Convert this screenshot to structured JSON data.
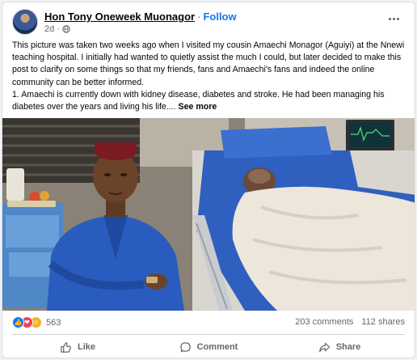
{
  "post": {
    "author": "Hon Tony Oneweek Muonagor",
    "separator": "·",
    "follow": "Follow",
    "time": "2d",
    "time_separator": "·",
    "more_icon": "more-horizontal-icon",
    "privacy_icon": "globe-icon"
  },
  "text": {
    "paragraph1": "This picture was taken two weeks ago when I visited my cousin Amaechi Monagor (Aguiyi) at the Nnewi teaching hospital. I initially had wanted to quietly assist the much I could, but later decided to make this post to clarify on some things so that my friends, fans and Amaechi's fans and indeed the online community can be better informed.",
    "paragraph2": "1. Amaechi is currently down with kidney disease, diabetes and stroke. He had been managing his diabetes over the years and living his life....",
    "see_more": "See more"
  },
  "stats": {
    "reaction_icons": [
      "like-icon",
      "love-icon",
      "care-icon"
    ],
    "reaction_count": "563",
    "comments": "203 comments",
    "shares": "112 shares"
  },
  "actions": {
    "like": "Like",
    "comment": "Comment",
    "share": "Share"
  },
  "colors": {
    "accent": "#1877f2",
    "secondary_text": "#65676b",
    "love": "#f33e58",
    "care": "#f7b125"
  }
}
